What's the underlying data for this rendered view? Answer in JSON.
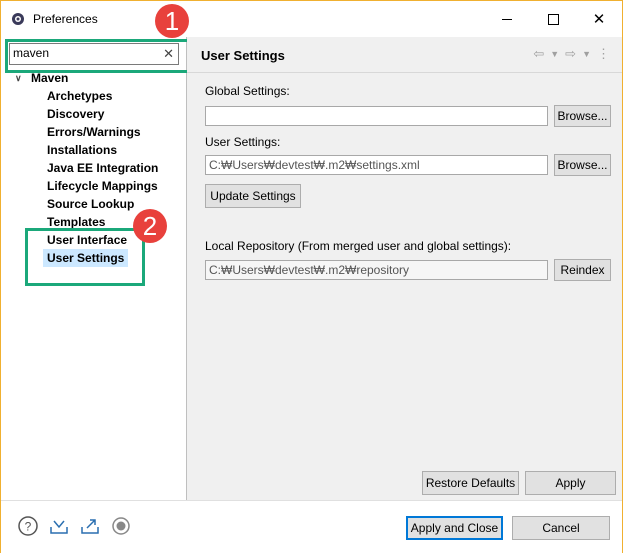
{
  "window": {
    "title": "Preferences"
  },
  "filter": {
    "value": "maven"
  },
  "tree": {
    "parent": "Maven",
    "items": [
      "Archetypes",
      "Discovery",
      "Errors/Warnings",
      "Installations",
      "Java EE Integration",
      "Lifecycle Mappings",
      "Source Lookup",
      "Templates",
      "User Interface",
      "User Settings"
    ]
  },
  "callouts": {
    "one": "1",
    "two": "2"
  },
  "page": {
    "title": "User Settings",
    "global_settings_label": "Global Settings:",
    "global_settings_value": "",
    "user_settings_label": "User Settings:",
    "user_settings_value": "C:₩Users₩devtest₩.m2₩settings.xml",
    "browse_label": "Browse...",
    "update_settings_label": "Update Settings",
    "local_repo_label": "Local Repository (From merged user and global settings):",
    "local_repo_value": "C:₩Users₩devtest₩.m2₩repository",
    "reindex_label": "Reindex",
    "restore_defaults_label": "Restore Defaults",
    "apply_label": "Apply"
  },
  "footer": {
    "apply_close_label": "Apply and Close",
    "cancel_label": "Cancel"
  },
  "colors": {
    "highlight": "#1ba87a",
    "badge": "#e8413c",
    "selection": "#cce8ff"
  }
}
